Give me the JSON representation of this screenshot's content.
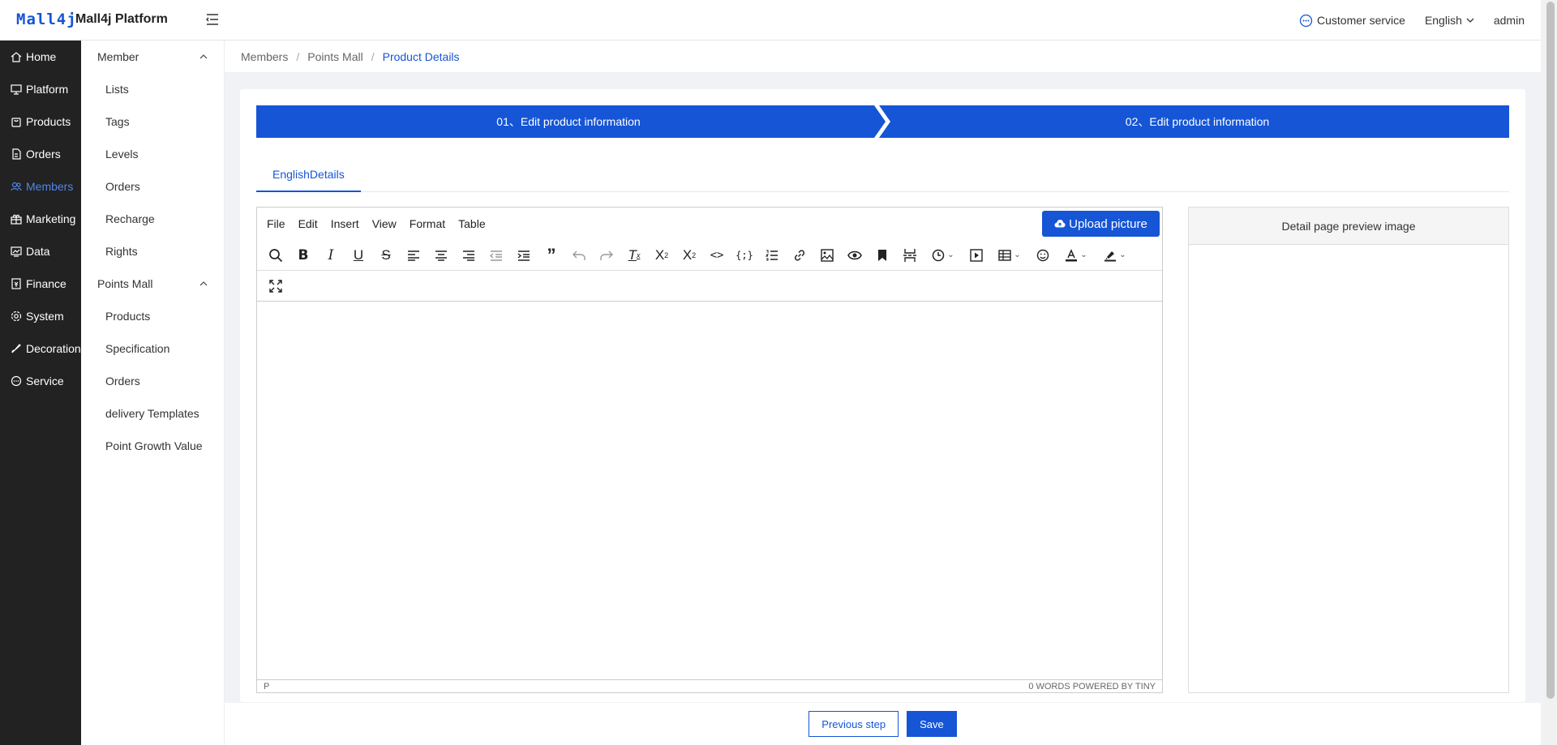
{
  "header": {
    "logo": "Mall4j",
    "platform_name": "Mall4j Platform",
    "customer_service": "Customer service",
    "language": "English",
    "user": "admin"
  },
  "sidebar_primary": [
    {
      "label": "Home",
      "icon": "home-icon"
    },
    {
      "label": "Platform",
      "icon": "monitor-icon"
    },
    {
      "label": "Products",
      "icon": "bag-icon"
    },
    {
      "label": "Orders",
      "icon": "document-icon"
    },
    {
      "label": "Members",
      "icon": "users-icon",
      "active": true
    },
    {
      "label": "Marketing",
      "icon": "gift-icon"
    },
    {
      "label": "Data",
      "icon": "chart-icon"
    },
    {
      "label": "Finance",
      "icon": "ledger-icon"
    },
    {
      "label": "System",
      "icon": "gear-icon"
    },
    {
      "label": "Decoration",
      "icon": "brush-icon"
    },
    {
      "label": "Service",
      "icon": "chat-icon"
    }
  ],
  "sidebar_secondary": {
    "group1": {
      "label": "Member",
      "items": [
        "Lists",
        "Tags",
        "Levels",
        "Orders",
        "Recharge",
        "Rights"
      ]
    },
    "group2": {
      "label": "Points Mall",
      "items": [
        "Products",
        "Specification",
        "Orders",
        "delivery Templates",
        "Point Growth Value"
      ]
    }
  },
  "breadcrumb": [
    "Members",
    "Points Mall",
    "Product Details"
  ],
  "steps": [
    "01、Edit product information",
    "02、Edit product information"
  ],
  "tabs": [
    "EnglishDetails"
  ],
  "editor": {
    "menus": [
      "File",
      "Edit",
      "Insert",
      "View",
      "Format",
      "Table"
    ],
    "upload_label": "Upload picture",
    "status_left": "P",
    "status_right": "0 WORDS  POWERED BY TINY"
  },
  "preview": {
    "title": "Detail page preview image"
  },
  "footer": {
    "prev_label": "Previous step",
    "save_label": "Save"
  },
  "colors": {
    "accent": "#1555d6",
    "sidebar_bg": "#222222"
  }
}
